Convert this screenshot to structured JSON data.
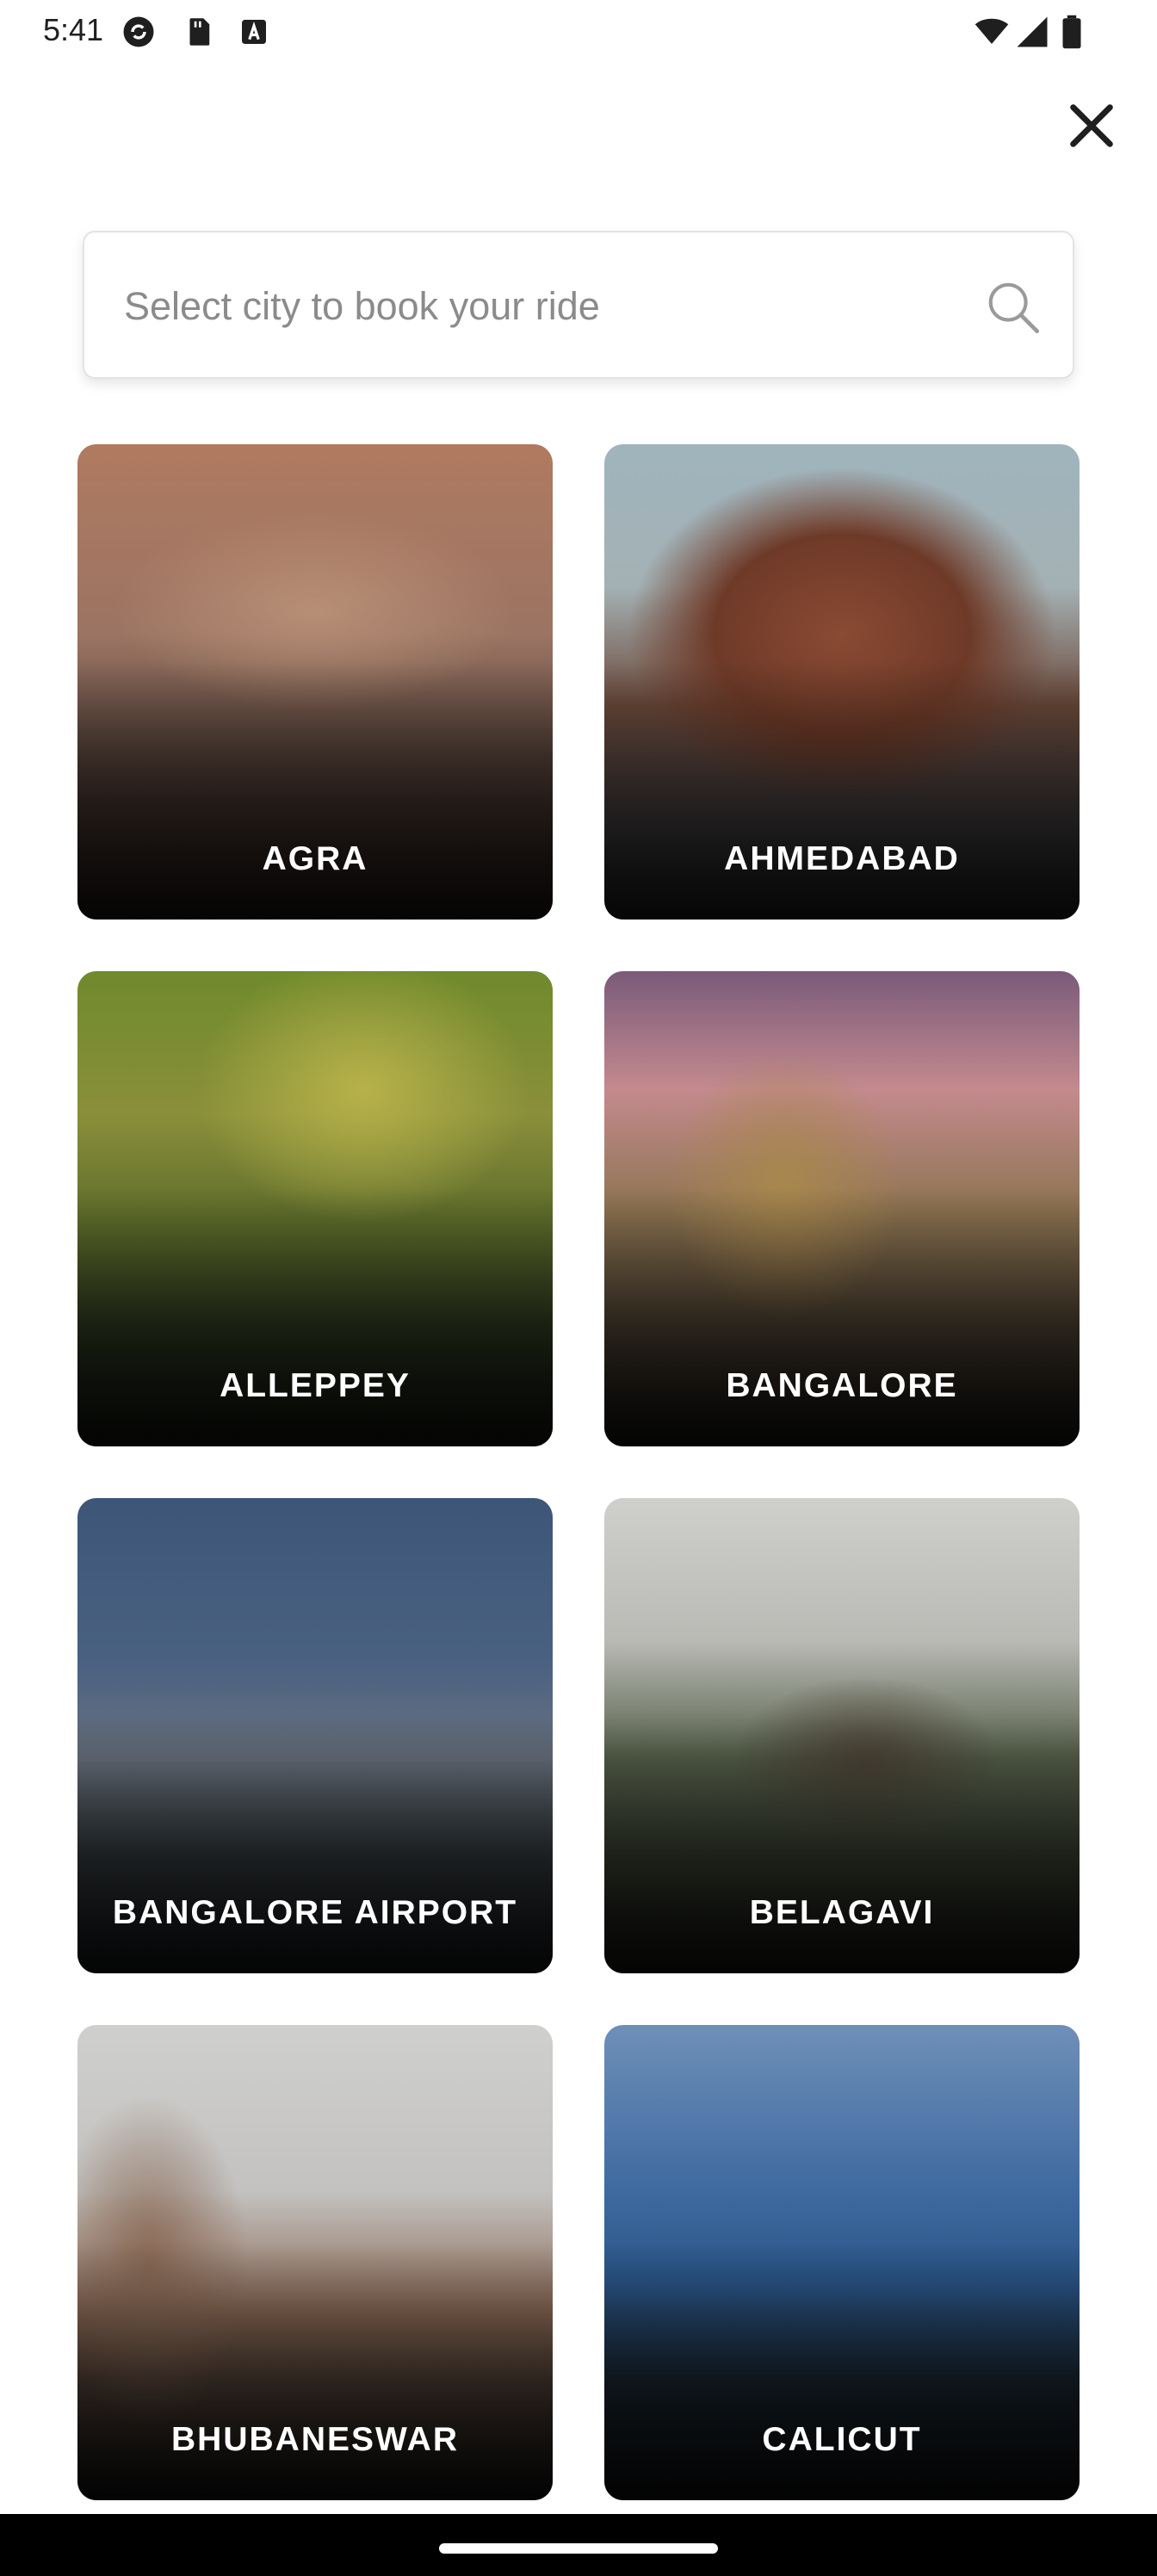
{
  "status_bar": {
    "time": "5:41",
    "icons": [
      "sync-icon",
      "sd-card-icon",
      "keyboard-a-icon",
      "wifi-icon",
      "cellular-signal-icon",
      "battery-icon"
    ]
  },
  "header": {
    "close_icon": "close-icon"
  },
  "search": {
    "placeholder": "Select city to book your ride",
    "value": "",
    "icon": "search-icon"
  },
  "cities": [
    {
      "name": "AGRA"
    },
    {
      "name": "AHMEDABAD"
    },
    {
      "name": "ALLEPPEY"
    },
    {
      "name": "BANGALORE"
    },
    {
      "name": "BANGALORE AIRPORT"
    },
    {
      "name": "BELAGAVI"
    },
    {
      "name": "BHUBANESWAR"
    },
    {
      "name": "CALICUT"
    }
  ],
  "colors": {
    "text_primary": "#1f1f1f",
    "placeholder": "#8b8b8b",
    "card_label": "#ffffff",
    "nav_bar": "#000000"
  }
}
